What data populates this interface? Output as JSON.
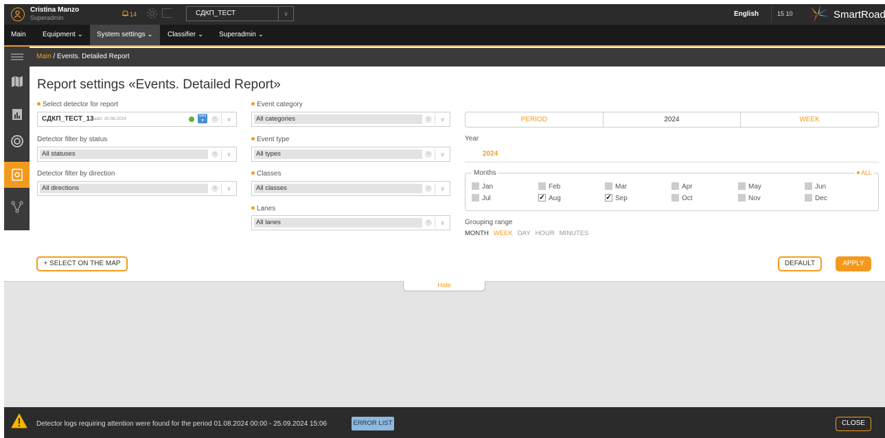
{
  "header": {
    "user_name": "Cristina Manzo",
    "user_role": "Superadmin",
    "notifications_count": "14",
    "org_select_value": "СДКП_ТЕСТ",
    "language": "English",
    "clock": "15 10",
    "brand": "SmartRoad"
  },
  "menu": {
    "items": [
      "Main",
      "Equipment ⌄",
      "System settings ⌄",
      "Classifier ⌄",
      "Superadmin ⌄"
    ]
  },
  "breadcrumb": {
    "link": "Main",
    "sep": " / ",
    "current": "Events. Detailed Report"
  },
  "page_title": "Report settings «Events. Detailed Report»",
  "detector": {
    "label": "Select detector for report",
    "name": "СДКП_ТЕСТ_13",
    "added": "add. 30.08.2024",
    "badge": "Gkm"
  },
  "status_filter": {
    "label": "Detector filter by status",
    "value": "All statuses"
  },
  "direction_filter": {
    "label": "Detector filter by direction",
    "value": "All directions"
  },
  "event_category": {
    "label": "Event category",
    "value": "All categories"
  },
  "event_type": {
    "label": "Event type",
    "value": "All types"
  },
  "classes": {
    "label": "Classes",
    "value": "All classes"
  },
  "lanes": {
    "label": "Lanes",
    "value": "All lanes"
  },
  "period_tabs": [
    "PERIOD",
    "2024",
    "WEEK"
  ],
  "year": {
    "label": "Year",
    "value": "2024"
  },
  "months": {
    "legend": "Months",
    "all": "ALL",
    "list": [
      {
        "name": "Jan",
        "checked": false
      },
      {
        "name": "Feb",
        "checked": false
      },
      {
        "name": "Mar",
        "checked": false
      },
      {
        "name": "Apr",
        "checked": false
      },
      {
        "name": "May",
        "checked": false
      },
      {
        "name": "Jun",
        "checked": false
      },
      {
        "name": "Jul",
        "checked": false
      },
      {
        "name": "Aug",
        "checked": true
      },
      {
        "name": "Sep",
        "checked": true
      },
      {
        "name": "Oct",
        "checked": false
      },
      {
        "name": "Nov",
        "checked": false
      },
      {
        "name": "Dec",
        "checked": false
      }
    ]
  },
  "grouping": {
    "label": "Grouping range",
    "options": [
      "MONTH",
      "WEEK",
      "DAY",
      "HOUR",
      "MINUTES"
    ],
    "selected": "WEEK"
  },
  "buttons": {
    "select_on_map": "+ SELECT ON THE MAP",
    "default": "DEFAULT",
    "apply": "APPLY",
    "hide": "Hide"
  },
  "alert": {
    "text": "Detector logs requiring attention were found for the period 01.08.2024 00:00 - 25.09.2024 15:06",
    "error_list": "ERROR LIST",
    "close": "CLOSE"
  },
  "colors": {
    "accent": "#f39a1e",
    "dark": "#2b2b2b",
    "ok": "#5cb52e"
  }
}
